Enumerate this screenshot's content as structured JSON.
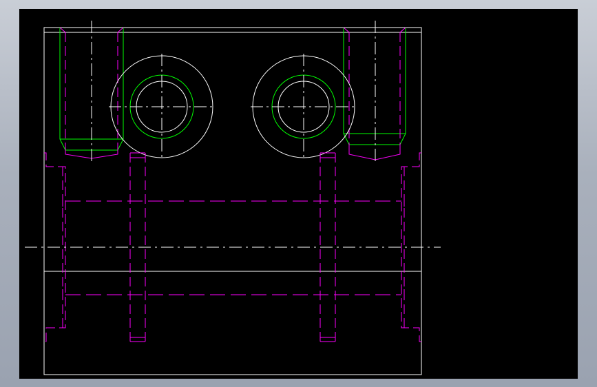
{
  "drawing": {
    "background_color": "#000000",
    "frame_color": "#9aa2b0",
    "outline_color": "#ffffff",
    "hidden_line_color": "#ff00ff",
    "thread_color": "#00ff00",
    "centerline_color": "#ffffff",
    "views": [
      "top-view",
      "front-view"
    ],
    "bolt_holes_count": 2,
    "counterbore_holes_count": 2
  }
}
